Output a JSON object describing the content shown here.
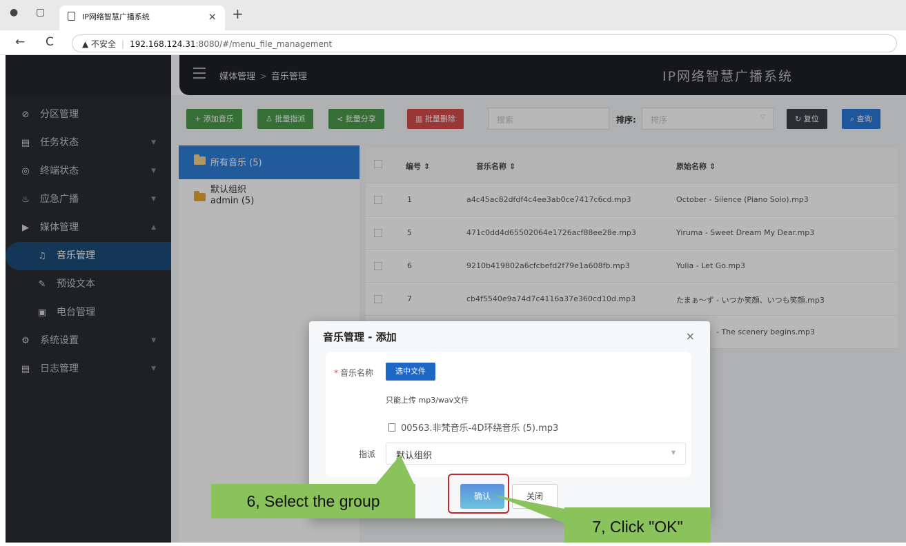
{
  "browser": {
    "tab_title": "IP网络智慧广播系统",
    "tab_close": "×",
    "new_tab": "+",
    "back": "←",
    "reload": "C",
    "security_warning": "▲ 不安全",
    "separator": "|",
    "url_host": "192.168.124.31",
    "url_path": ":8080/#/menu_file_management"
  },
  "header": {
    "breadcrumb_parent": "媒体管理",
    "breadcrumb_sep": ">",
    "breadcrumb_current": "音乐管理",
    "system_title": "IP网络智慧广播系统"
  },
  "sidebar": {
    "items": [
      {
        "icon": "link-icon",
        "glyph": "⊘",
        "label": "分区管理",
        "arrow": ""
      },
      {
        "icon": "task-icon",
        "glyph": "▤",
        "label": "任务状态",
        "arrow": "▼"
      },
      {
        "icon": "terminal-icon",
        "glyph": "◎",
        "label": "终端状态",
        "arrow": "▼"
      },
      {
        "icon": "emergency-icon",
        "glyph": "♨",
        "label": "应急广播",
        "arrow": "▼"
      },
      {
        "icon": "media-icon",
        "glyph": "▶",
        "label": "媒体管理",
        "arrow": "▲"
      },
      {
        "icon": "music-icon",
        "glyph": "♫",
        "label": "音乐管理",
        "arrow": ""
      },
      {
        "icon": "preset-text-icon",
        "glyph": "✎",
        "label": "预设文本",
        "arrow": ""
      },
      {
        "icon": "radio-icon",
        "glyph": "▣",
        "label": "电台管理",
        "arrow": ""
      },
      {
        "icon": "settings-icon",
        "glyph": "⚙",
        "label": "系统设置",
        "arrow": "▼"
      },
      {
        "icon": "log-icon",
        "glyph": "▤",
        "label": "日志管理",
        "arrow": "▼"
      }
    ]
  },
  "toolbar": {
    "add_music": "+ 添加音乐",
    "batch_assign": "♙ 批量指派",
    "batch_share": "< 批量分享",
    "batch_delete": "▥ 批量删除",
    "search_placeholder": "搜索",
    "sort_label": "排序:",
    "sort_placeholder": "排序",
    "reset": "↻ 复位",
    "query": "⌕ 查询"
  },
  "tree": {
    "all_music": "所有音乐 (5)",
    "group_line1": "默认组织",
    "group_line2": "admin (5)"
  },
  "table": {
    "headers": [
      "编号 ⇕",
      "音乐名称 ⇕",
      "原始名称 ⇕"
    ],
    "rows": [
      {
        "id": "1",
        "name": "a4c45ac82dfdf4c4ee3ab0ce7417c6cd.mp3",
        "original": "October - Silence (Piano Solo).mp3"
      },
      {
        "id": "5",
        "name": "471c0dd4d65502064e1726acf88ee28e.mp3",
        "original": "Yiruma - Sweet Dream My Dear.mp3"
      },
      {
        "id": "6",
        "name": "9210b419802a6cfcbefd2f79e1a608fb.mp3",
        "original": "Yulia - Let Go.mp3"
      },
      {
        "id": "7",
        "name": "cb4f5540e9a74d7c4116a37e360cd10d.mp3",
        "original": "たまぁ～ず - いつか笑顔、いつも笑顔.mp3"
      }
    ],
    "partial_original": "- The scenery begins.mp3"
  },
  "dialog": {
    "title": "音乐管理 - 添加",
    "close": "×",
    "required_mark": "*",
    "music_name_label": "音乐名称",
    "select_file_button": "选中文件",
    "upload_hint": "只能上传 mp3/wav文件",
    "selected_file": "00563.非梵音乐-4D环绕音乐 (5).mp3",
    "assign_label": "指派",
    "assign_value": "默认组织",
    "confirm_button": "确认",
    "cancel_button": "关闭"
  },
  "annotations": {
    "step6": "6, Select the group",
    "step7": "7, Click \"OK\""
  },
  "colors": {
    "callout_green": "#8ac25b",
    "highlight_red": "#c4262e",
    "primary_blue": "#1f67c4"
  }
}
